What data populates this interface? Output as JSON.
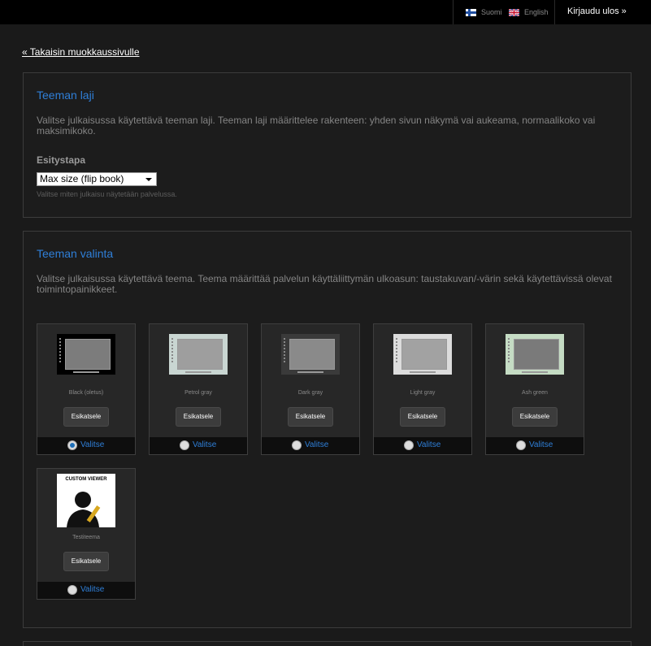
{
  "topbar": {
    "lang_fi": "Suomi",
    "lang_en": "English",
    "logout": "Kirjaudu ulos »"
  },
  "back_link": "« Takaisin muokkaussivulle",
  "type_section": {
    "title": "Teeman laji",
    "description": "Valitse julkaisussa käytettävä teeman laji. Teeman laji määrittelee rakenteen: yhden sivun näkymä vai aukeama, normaalikoko vai maksimikoko.",
    "field_label": "Esitystapa",
    "select_value": "Max size (flip book)",
    "hint": "Valitse miten julkaisu näytetään palvelussa."
  },
  "theme_section": {
    "title": "Teeman valinta",
    "description": "Valitse julkaisussa käytettävä teema. Teema määrittää palvelun käyttäliittymän ulkoasun: taustakuvan/-värin sekä käytettävissä olevat toimintopainikkeet.",
    "preview_label": "Esikatsele",
    "select_label": "Valitse",
    "custom_viewer_text": "CUSTOM VIEWER",
    "themes": [
      {
        "name": "Black (oletus)",
        "selected": true,
        "bg": "#000000",
        "page": "#7c7c7c"
      },
      {
        "name": "Petrol gray",
        "selected": false,
        "bg": "#c9d6d2",
        "page": "#9e9e9e"
      },
      {
        "name": "Dark gray",
        "selected": false,
        "bg": "#3a3a3a",
        "page": "#8a8a8a"
      },
      {
        "name": "Light gray",
        "selected": false,
        "bg": "#dcdcdc",
        "page": "#a2a2a2"
      },
      {
        "name": "Ash green",
        "selected": false,
        "bg": "#c5dcc4",
        "page": "#7a7a7a"
      },
      {
        "name": "Testiteema",
        "selected": false,
        "custom": true
      }
    ]
  },
  "colors": {
    "accent": "#2f7fd8",
    "background": "#1a1a1a",
    "panel_border": "#3c3c3c"
  }
}
